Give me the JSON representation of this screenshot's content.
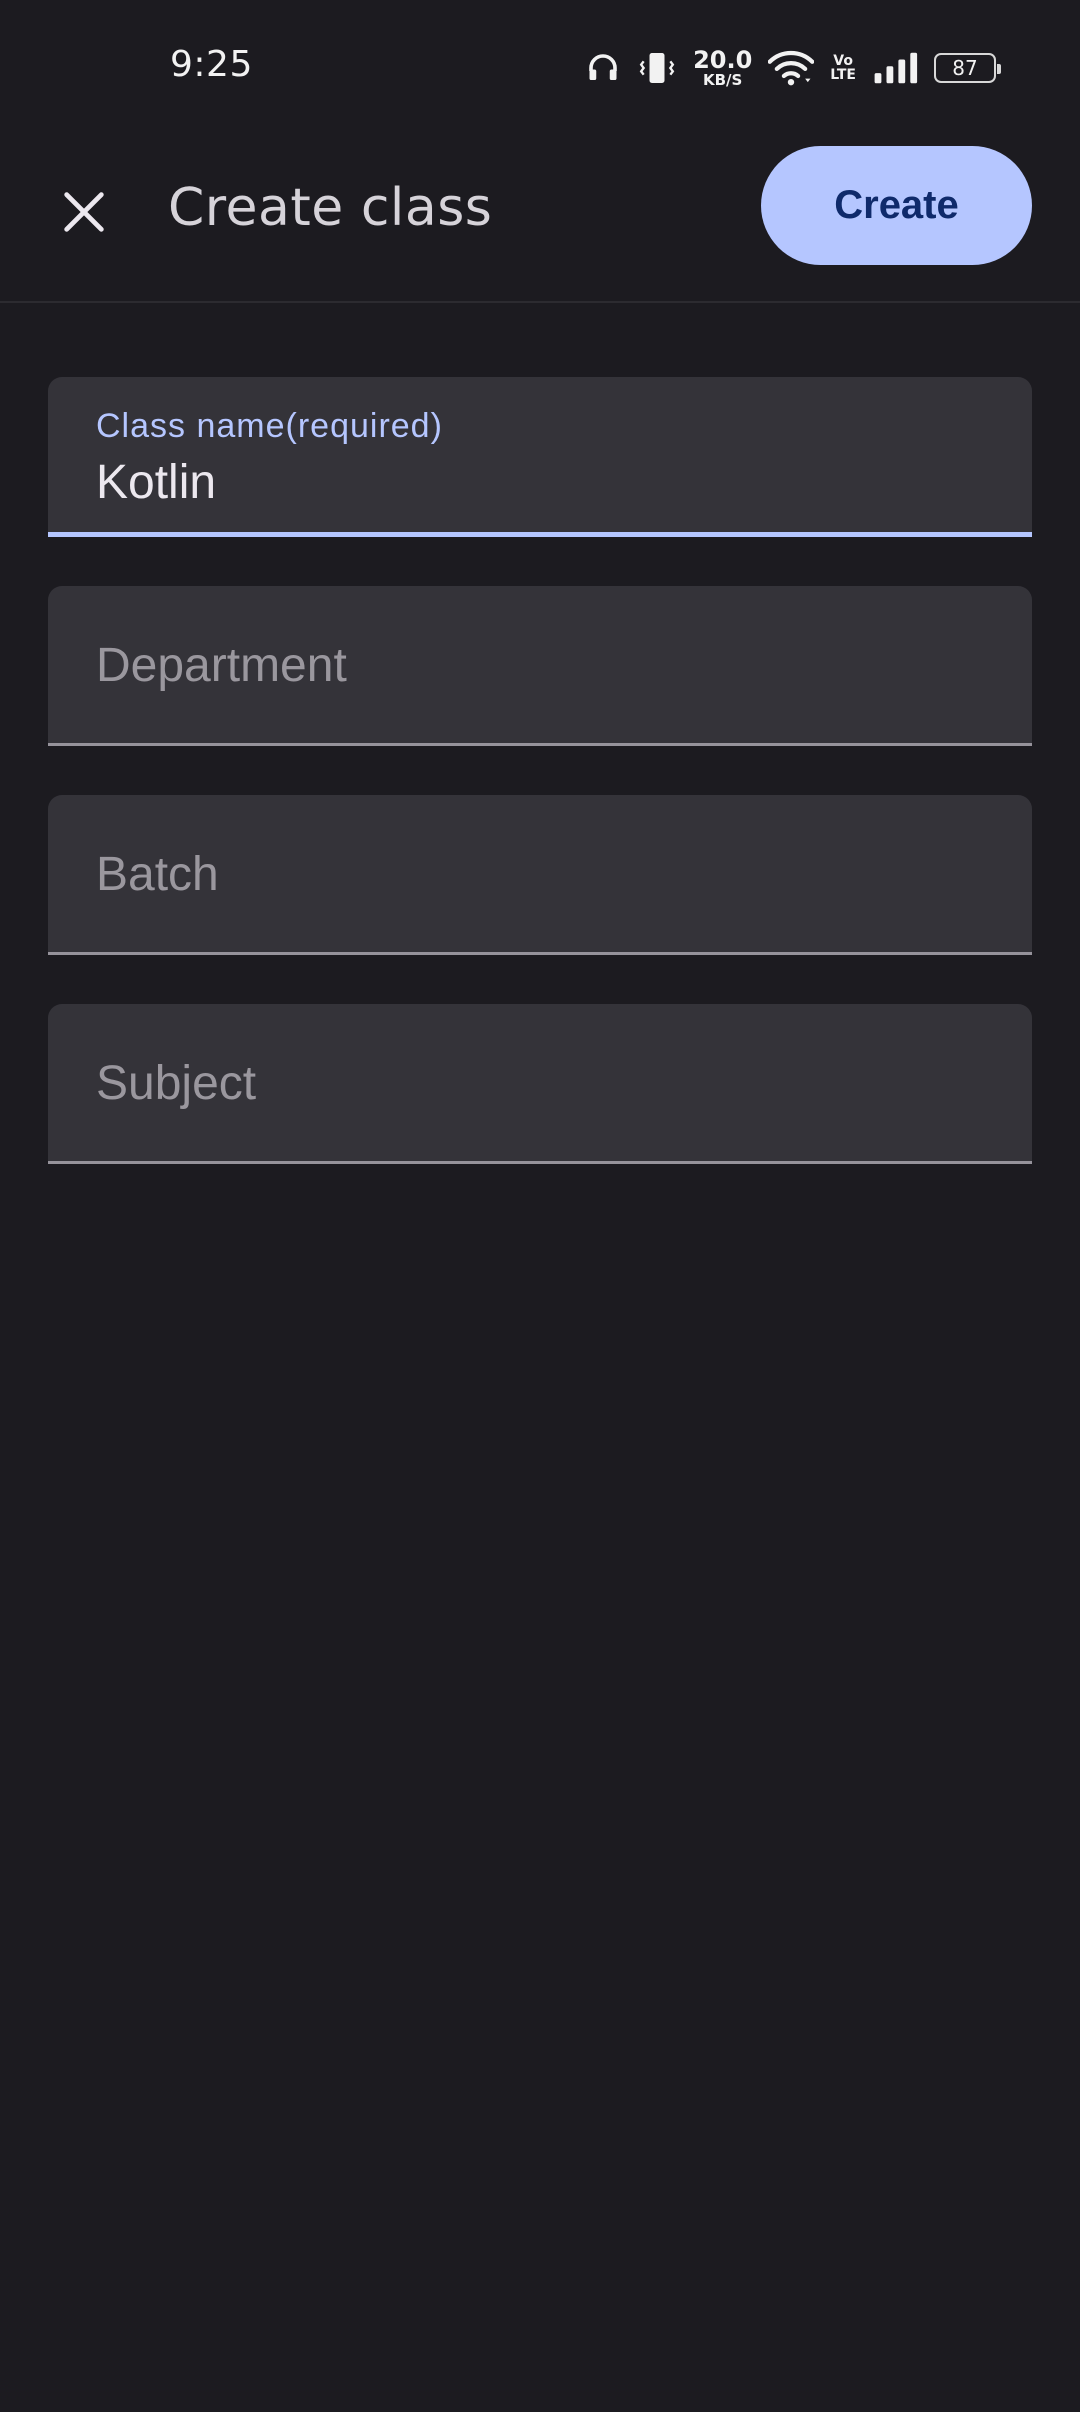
{
  "status_bar": {
    "time": "9:25",
    "net_speed_value": "20.0",
    "net_speed_unit": "KB/S",
    "volte_top": "Vo",
    "volte_bottom": "LTE",
    "battery": "87",
    "icons": [
      "headphones-icon",
      "vibrate-icon",
      "wifi-icon",
      "volte-icon",
      "signal-icon",
      "battery-icon"
    ]
  },
  "app_bar": {
    "title": "Create class",
    "close_icon": "close-icon",
    "create_label": "Create"
  },
  "form": {
    "class_name": {
      "label": "Class name(required)",
      "value": "Kotlin"
    },
    "department": {
      "placeholder": "Department"
    },
    "batch": {
      "placeholder": "Batch"
    },
    "subject": {
      "placeholder": "Subject"
    }
  },
  "colors": {
    "background": "#1c1b20",
    "field_bg": "#343339",
    "accent": "#b5c6ff",
    "button_text": "#0f2a6b"
  }
}
